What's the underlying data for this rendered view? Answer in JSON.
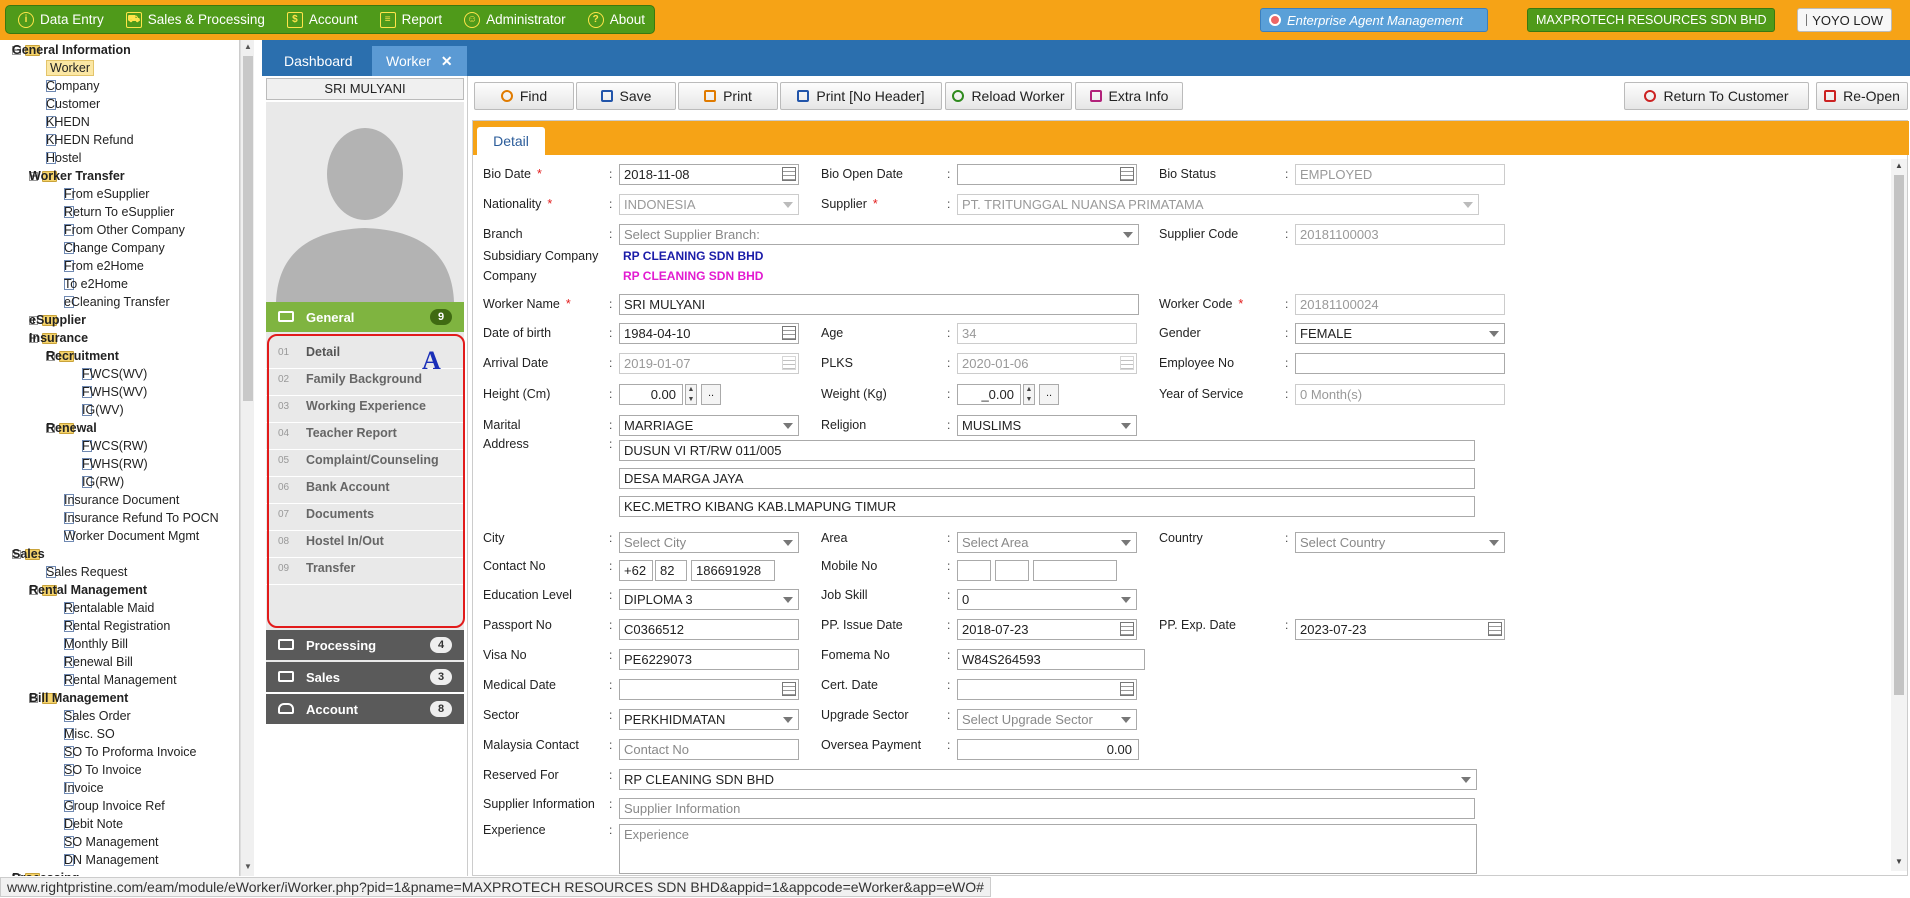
{
  "menu": {
    "items": [
      {
        "label": "Data Entry",
        "icon": "info-icon"
      },
      {
        "label": "Sales & Processing",
        "icon": "cart-icon"
      },
      {
        "label": "Account",
        "icon": "dollar-icon"
      },
      {
        "label": "Report",
        "icon": "table-icon"
      },
      {
        "label": "Administrator",
        "icon": "users-icon"
      },
      {
        "label": "About",
        "icon": "question-icon"
      }
    ],
    "eam": "Enterprise Agent Management",
    "company": "MAXPROTECH RESOURCES SDN BHD",
    "user": "YOYO LOW"
  },
  "tree": {
    "nodes": [
      {
        "label": "General Information",
        "type": "group",
        "toggle": "−"
      },
      {
        "label": "Worker",
        "type": "doc"
      },
      {
        "label": "Company",
        "type": "doc"
      },
      {
        "label": "Customer",
        "type": "doc"
      },
      {
        "label": "KHEDN",
        "type": "doc"
      },
      {
        "label": "KHEDN Refund",
        "type": "doc"
      },
      {
        "label": "Hostel",
        "type": "doc"
      },
      {
        "label": "Worker Transfer",
        "type": "group",
        "toggle": "−"
      },
      {
        "label": "From eSupplier",
        "type": "doc"
      },
      {
        "label": "Return To eSupplier",
        "type": "doc"
      },
      {
        "label": "From Other Company",
        "type": "doc"
      },
      {
        "label": "Change Company",
        "type": "doc"
      },
      {
        "label": "From e2Home",
        "type": "doc"
      },
      {
        "label": "To e2Home",
        "type": "doc"
      },
      {
        "label": "eCleaning Transfer",
        "type": "doc"
      },
      {
        "label": "eSupplier",
        "type": "group",
        "toggle": "+"
      },
      {
        "label": "Insurance",
        "type": "group",
        "toggle": "−"
      },
      {
        "label": "Recruitment",
        "type": "group",
        "toggle": "−"
      },
      {
        "label": "FWCS(WV)",
        "type": "doc"
      },
      {
        "label": "FWHS(WV)",
        "type": "doc"
      },
      {
        "label": "IG(WV)",
        "type": "doc"
      },
      {
        "label": "Renewal",
        "type": "group",
        "toggle": "−"
      },
      {
        "label": "FWCS(RW)",
        "type": "doc"
      },
      {
        "label": "FWHS(RW)",
        "type": "doc"
      },
      {
        "label": "IG(RW)",
        "type": "doc"
      },
      {
        "label": "Insurance Document",
        "type": "doc"
      },
      {
        "label": "Insurance Refund To POCN",
        "type": "doc"
      },
      {
        "label": "Worker Document Mgmt",
        "type": "doc"
      },
      {
        "label": "Sales",
        "type": "group",
        "toggle": "−"
      },
      {
        "label": "Sales Request",
        "type": "doc"
      },
      {
        "label": "Rental Management",
        "type": "group",
        "toggle": "−"
      },
      {
        "label": "Rentalable Maid",
        "type": "doc"
      },
      {
        "label": "Rental Registration",
        "type": "doc"
      },
      {
        "label": "Monthly Bill",
        "type": "doc"
      },
      {
        "label": "Renewal Bill",
        "type": "doc"
      },
      {
        "label": "Rental Management",
        "type": "doc"
      },
      {
        "label": "Bill Management",
        "type": "group",
        "toggle": "−"
      },
      {
        "label": "Sales Order",
        "type": "doc"
      },
      {
        "label": "Misc. SO",
        "type": "doc"
      },
      {
        "label": "SO To Proforma Invoice",
        "type": "doc"
      },
      {
        "label": "SO To Invoice",
        "type": "doc"
      },
      {
        "label": "Invoice",
        "type": "doc"
      },
      {
        "label": "Group Invoice Ref",
        "type": "doc"
      },
      {
        "label": "Debit Note",
        "type": "doc"
      },
      {
        "label": "SO Management",
        "type": "doc"
      },
      {
        "label": "DN Management",
        "type": "doc"
      },
      {
        "label": "Processing",
        "type": "group",
        "toggle": "−"
      }
    ]
  },
  "tabs": {
    "dashboard": "Dashboard",
    "worker": "Worker",
    "close": "✕"
  },
  "worker": {
    "name_header": "SRI MULYANI",
    "sections": {
      "general": {
        "label": "General",
        "count": "9"
      },
      "processing": {
        "label": "Processing",
        "count": "4"
      },
      "sales": {
        "label": "Sales",
        "count": "3"
      },
      "account": {
        "label": "Account",
        "count": "8"
      }
    },
    "subitems": [
      {
        "num": "01",
        "label": "Detail"
      },
      {
        "num": "02",
        "label": "Family Background"
      },
      {
        "num": "03",
        "label": "Working Experience"
      },
      {
        "num": "04",
        "label": "Teacher Report"
      },
      {
        "num": "05",
        "label": "Complaint/Counseling"
      },
      {
        "num": "06",
        "label": "Bank Account"
      },
      {
        "num": "07",
        "label": "Documents"
      },
      {
        "num": "08",
        "label": "Hostel In/Out"
      },
      {
        "num": "09",
        "label": "Transfer"
      }
    ],
    "annotation": "A"
  },
  "toolbar": {
    "find": "Find",
    "save": "Save",
    "print": "Print",
    "print_no_header": "Print [No Header]",
    "reload": "Reload Worker",
    "extra": "Extra Info",
    "return_customer": "Return To Customer",
    "reopen": "Re-Open"
  },
  "detail": {
    "tab": "Detail",
    "labels": {
      "bio_date": "Bio Date",
      "bio_open_date": "Bio Open Date",
      "bio_status": "Bio Status",
      "nationality": "Nationality",
      "supplier": "Supplier",
      "branch": "Branch",
      "supplier_code": "Supplier Code",
      "subsidiary": "Subsidiary Company",
      "company": "Company",
      "worker_name": "Worker Name",
      "worker_code": "Worker Code",
      "dob": "Date of birth",
      "age": "Age",
      "gender": "Gender",
      "arrival": "Arrival Date",
      "plks": "PLKS",
      "employee_no": "Employee No",
      "height": "Height (Cm)",
      "weight": "Weight (Kg)",
      "yos": "Year of Service",
      "marital": "Marital",
      "religion": "Religion",
      "address": "Address",
      "city": "City",
      "area": "Area",
      "country": "Country",
      "contact": "Contact No",
      "mobile": "Mobile No",
      "education": "Education Level",
      "job_skill": "Job Skill",
      "passport": "Passport No",
      "pp_issue": "PP. Issue Date",
      "pp_exp": "PP. Exp. Date",
      "visa": "Visa No",
      "fomema": "Fomema No",
      "medical": "Medical Date",
      "cert": "Cert. Date",
      "sector": "Sector",
      "upgrade_sector": "Upgrade Sector",
      "my_contact": "Malaysia Contact",
      "oversea": "Oversea Payment",
      "reserved": "Reserved For",
      "supplier_info": "Supplier Information",
      "experience": "Experience"
    },
    "required_mark": "*",
    "colon": ":",
    "values": {
      "bio_date": "2018-11-08",
      "bio_open_date": "",
      "bio_status": "EMPLOYED",
      "nationality": "INDONESIA",
      "supplier": "PT. TRITUNGGAL NUANSA PRIMATAMA",
      "branch_placeholder": "Select Supplier Branch:",
      "supplier_code": "20181100003",
      "subsidiary": "RP CLEANING SDN BHD",
      "company": "RP CLEANING SDN BHD",
      "worker_name": "SRI MULYANI",
      "worker_code": "20181100024",
      "dob": "1984-04-10",
      "age": "34",
      "gender": "FEMALE",
      "arrival": "2019-01-07",
      "plks": "2020-01-06",
      "employee_no": "",
      "height": "0.00",
      "weight": "_0.00",
      "yos": "0 Month(s)",
      "marital": "MARRIAGE",
      "religion": "MUSLIMS",
      "address1": "DUSUN VI RT/RW 011/005",
      "address2": "DESA MARGA JAYA",
      "address3": "KEC.METRO KIBANG  KAB.LMAPUNG TIMUR",
      "city_placeholder": "Select City",
      "area_placeholder": "Select Area",
      "country_placeholder": "Select Country",
      "contact_cc": "+62",
      "contact_ac": "82",
      "contact_no": "186691928",
      "education": "DIPLOMA 3",
      "job_skill": "0",
      "passport": "C0366512",
      "pp_issue": "2018-07-23",
      "pp_exp": "2023-07-23",
      "visa": "PE6229073",
      "fomema": "W84S264593",
      "sector": "PERKHIDMATAN",
      "upgrade_sector_placeholder": "Select Upgrade Sector",
      "my_contact_placeholder": "Contact No",
      "oversea": "0.00",
      "reserved": "RP CLEANING SDN BHD",
      "supplier_info_placeholder": "Supplier Information",
      "experience_placeholder": "Experience",
      "dots": ".."
    }
  },
  "status": {
    "url": "www.rightpristine.com/eam/module/eWorker/iWorker.php?pid=1&pname=MAXPROTECH RESOURCES SDN BHD&appid=1&appcode=eWorker&app=eWO#"
  },
  "colors": {
    "topbar": "#f6a316",
    "menu_green": "#4f9a1a",
    "tabbar_blue": "#2b6fae",
    "required": "#e21b1b",
    "company_pink": "#e21bd1"
  }
}
